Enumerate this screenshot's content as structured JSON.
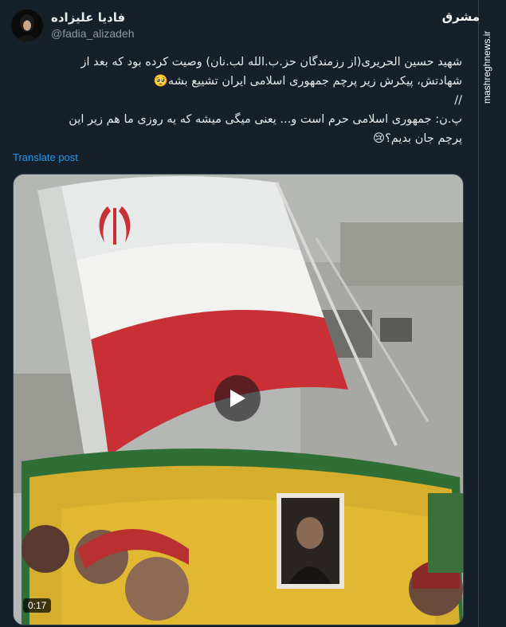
{
  "author": {
    "name": "فادیا علیزاده",
    "handle": "@fadia_alizadeh"
  },
  "post": {
    "line1": "شهید حسین الحریری(از رزمندگان حز.ب.الله لب.نان) وصیت کرده بود که بعد از",
    "line2": "شهادتش، پیکرش زیر پرچم جمهوری اسلامی ایران تشییع بشه🥺",
    "line3": "//",
    "line4": "پ.ن: جمهوری اسلامی حرم است و... یعنی میگی میشه که یه روزی ما هم زیر این",
    "line5": "پرچم جان بدیم؟😢"
  },
  "translate_label": "Translate post",
  "video": {
    "duration": "0:17"
  },
  "watermark": {
    "logo": "مشرق",
    "site": "mashreghnews.ir"
  },
  "icons": {
    "play": "play-icon"
  }
}
